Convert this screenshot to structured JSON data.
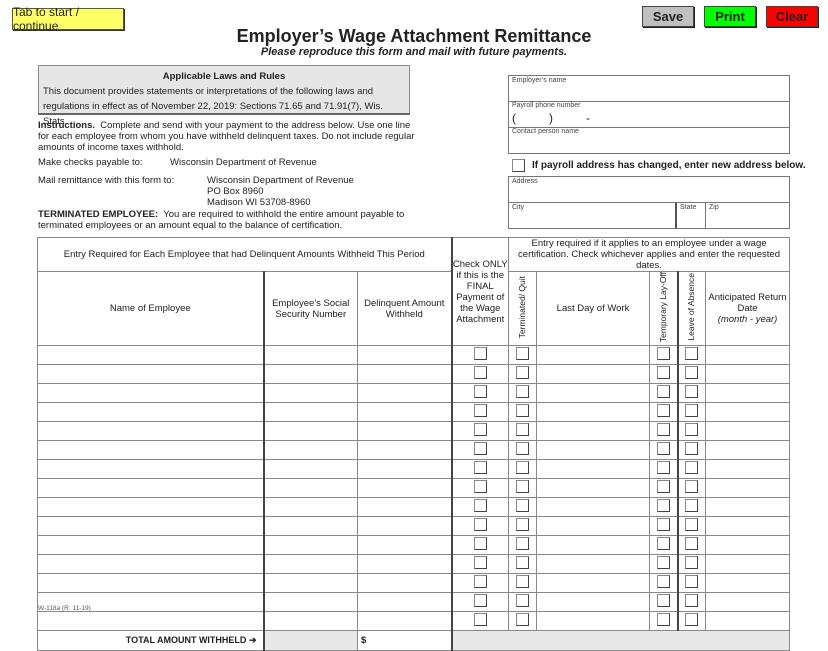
{
  "toolbar": {
    "tab_label": "Tab to start / continue",
    "save_label": "Save",
    "print_label": "Print",
    "clear_label": "Clear",
    "colors": {
      "tab": "#ffff66",
      "save": "#c0c0c0",
      "print": "#00ff00",
      "clear": "#ff0000"
    }
  },
  "header": {
    "title": "Employer’s Wage Attachment Remittance",
    "subtitle": "Please reproduce this form and mail with future payments."
  },
  "laws": {
    "heading": "Applicable Laws and Rules",
    "body": "This document provides statements or interpretations of the following laws and regulations in effect as of November 22, 2019: Sections 71.65 and 71.91(7), Wis. Stats."
  },
  "instructions": {
    "label": "Instructions.",
    "text": "Complete and send with your payment to the address below.  Use one line for each employee from whom you have withheld delinquent taxes.  Do not include regular amounts of income taxes withhold.",
    "payable_label": "Make checks payable to:",
    "payable_value": "Wisconsin Department of Revenue",
    "mail_label": "Mail remittance with this form to:",
    "mail_lines": [
      "Wisconsin Department of Revenue",
      "PO Box 8960",
      "Madison WI  53708-8960"
    ],
    "terminated_label": "TERMINATED EMPLOYEE:",
    "terminated_text": "You are required to withhold the entire amount payable to terminated employees or an amount equal to the balance of certification."
  },
  "employer": {
    "name_label": "Employer’s name",
    "phone_label": "Payroll phone number",
    "phone_mask_open": "(",
    "phone_mask_close": ")",
    "phone_mask_dash": "-",
    "contact_label": "Contact person name",
    "address_changed_label": "If payroll address has changed, enter new address below.",
    "address_label": "Address",
    "city_label": "City",
    "state_label": "State",
    "zip_label": "Zip"
  },
  "table": {
    "group_left": "Entry Required for Each Employee that had Delinquent Amounts Withheld This Period",
    "group_right": "Entry required if it applies to an employee under a wage certification. Check whichever applies and enter the requested dates.",
    "col_name": "Name of Employee",
    "col_ssn": "Employee's Social Security Number",
    "col_amount": "Delinquent Amount Withheld",
    "col_final": "Check ONLY if this is the FINAL Payment of the Wage Attachment",
    "col_terminated": "Terminated/ Quit",
    "col_lastday": "Last Day of Work",
    "col_layoff": "Temporary Lay-Off",
    "col_leave": "Leave of Absence",
    "col_return": "Anticipated Return Date",
    "col_return_sub": "(month - year)",
    "row_count": 15,
    "total_label": "TOTAL AMOUNT WITHHELD",
    "total_arrow": "➔",
    "total_currency": "$"
  },
  "footer": {
    "form_id": "W-118a (R. 11-19)"
  }
}
